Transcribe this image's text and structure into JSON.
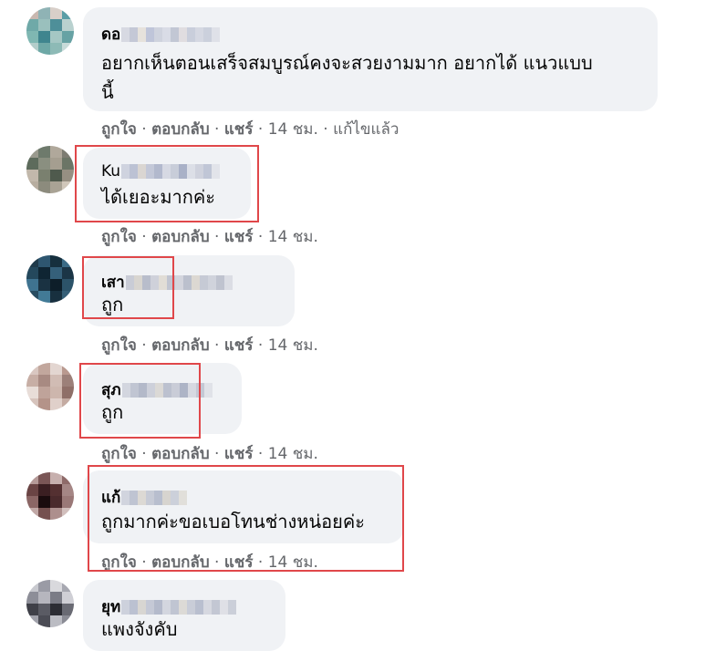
{
  "comments": [
    {
      "name": "ดอ",
      "text_lines": [
        "อยากเห็นตอนเสร็จสมบูรณ์คงจะสวยงามมาก อยากได้ แนวแบบ",
        "นี้"
      ],
      "like": "ถูกใจ",
      "reply": "ตอบกลับ",
      "share": "แชร์",
      "time": "14 ชม.",
      "edited": "แก้ไขแล้ว"
    },
    {
      "name": "Ku",
      "text_lines": [
        "ได้เยอะมากค่ะ"
      ],
      "like": "ถูกใจ",
      "reply": "ตอบกลับ",
      "share": "แชร์",
      "time": "14 ชม."
    },
    {
      "name": "เสา",
      "text_lines": [
        "ถูก"
      ],
      "like": "ถูกใจ",
      "reply": "ตอบกลับ",
      "share": "แชร์",
      "time": "14 ชม."
    },
    {
      "name": "สุภ",
      "text_lines": [
        "ถูก"
      ],
      "like": "ถูกใจ",
      "reply": "ตอบกลับ",
      "share": "แชร์",
      "time": "14 ชม."
    },
    {
      "name": "แก้",
      "text_lines": [
        "ถูกมากค่ะขอเบอโทนช่างหน่อยค่ะ"
      ],
      "like": "ถูกใจ",
      "reply": "ตอบกลับ",
      "share": "แชร์",
      "time": "14 ชม."
    },
    {
      "name": "ยุท",
      "text_lines": [
        "แพงจังคับ"
      ]
    }
  ],
  "separator": " · ",
  "colors": {
    "bubble": "#f0f2f5",
    "highlight": "#e0474a",
    "meta_text": "#65676b"
  }
}
